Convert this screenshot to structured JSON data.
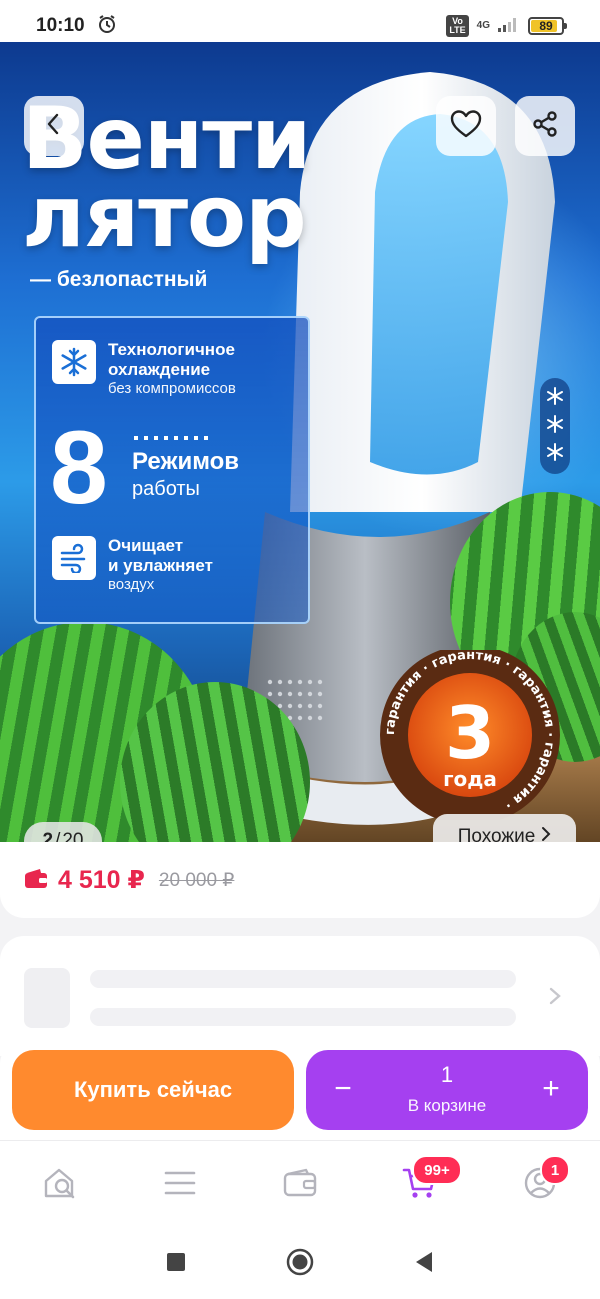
{
  "status_bar": {
    "time": "10:10",
    "network": "4G",
    "battery_level": "89"
  },
  "product": {
    "promo": {
      "title_line1": "Венти",
      "title_line2": "лятор",
      "subtitle": "— безлопастный",
      "features": [
        {
          "title_line1": "Технологичное",
          "title_line2": "охлаждение",
          "subtitle": "без компромиссов",
          "icon": "snowflake-icon"
        },
        {
          "title_line1": "Очищает",
          "title_line2": "и увлажняет",
          "subtitle": "воздух",
          "icon": "wind-icon"
        }
      ],
      "modes_number": "8",
      "modes_label": "Режимов",
      "modes_sub": "работы",
      "warranty_number": "3",
      "warranty_unit": "года",
      "warranty_ring_text": "гарантия · гарантия · гарантия · гарантия ·"
    },
    "gallery": {
      "current": "2",
      "separator": "/",
      "total": "20"
    },
    "similar_label": "Похожие",
    "price_current": "4 510 ₽",
    "price_old": "20 000 ₽"
  },
  "actions": {
    "buy_now": "Купить сейчас",
    "cart_minus": "−",
    "cart_plus": "+",
    "cart_quantity": "1",
    "cart_label": "В корзине"
  },
  "bottom_nav": {
    "cart_badge": "99+",
    "profile_badge": "1"
  },
  "colors": {
    "accent_price": "#e8264e",
    "buy_now": "#ff8a2e",
    "cart": "#a540f0",
    "badge": "#ff2d55"
  }
}
